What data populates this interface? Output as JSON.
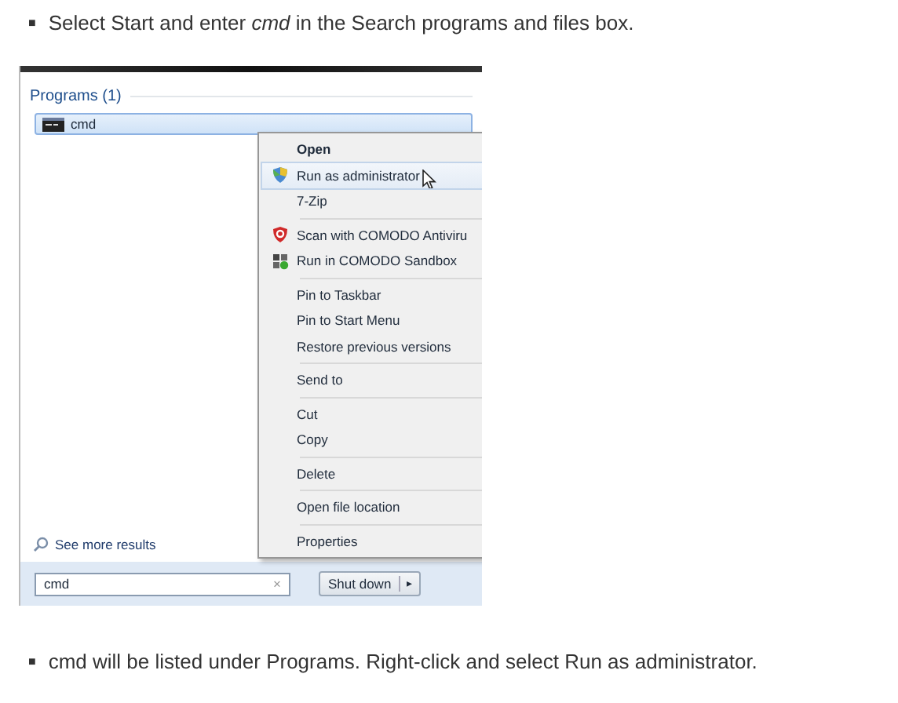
{
  "steps": [
    {
      "bullet": "■",
      "text": "Select Start and enter *cmd* in the Search programs and files box."
    },
    {
      "bullet": "■",
      "text": "cmd will be listed under Programs. Right-click and select Run as administrator."
    }
  ],
  "start_menu": {
    "section_title": "Programs (1)",
    "results": [
      {
        "label": "cmd",
        "selected": true
      }
    ],
    "see_more": "See more results",
    "search": {
      "value": "cmd",
      "clear": "×"
    },
    "shutdown": {
      "label": "Shut down",
      "arrow": "▸"
    }
  },
  "context_menu": {
    "groups": [
      [
        {
          "label": "Open",
          "default": true,
          "selected": false
        },
        {
          "label": "Run as administrator",
          "kind": "shield",
          "default": false,
          "selected": true,
          "pointer": true
        },
        {
          "label": "7-Zip",
          "default": false,
          "selected": false
        }
      ],
      [
        {
          "label": "Scan with COMODO Antiviru",
          "kind": "comodo",
          "default": false,
          "selected": false
        },
        {
          "label": "Run in COMODO Sandbox",
          "kind": "sandbox",
          "default": false,
          "selected": false
        }
      ],
      [
        {
          "label": "Pin to Taskbar",
          "default": false,
          "selected": false
        },
        {
          "label": "Pin to Start Menu",
          "default": false,
          "selected": false
        },
        {
          "label": "Restore previous versions",
          "default": false,
          "selected": false
        }
      ],
      [
        {
          "label": "Send to",
          "default": false,
          "selected": false
        }
      ],
      [
        {
          "label": "Cut",
          "default": false,
          "selected": false
        },
        {
          "label": "Copy",
          "default": false,
          "selected": false
        }
      ],
      [
        {
          "label": "Delete",
          "default": false,
          "selected": false
        }
      ],
      [
        {
          "label": "Open file location",
          "default": false,
          "selected": false
        }
      ],
      [
        {
          "label": "Properties",
          "default": false,
          "selected": false
        }
      ]
    ]
  }
}
